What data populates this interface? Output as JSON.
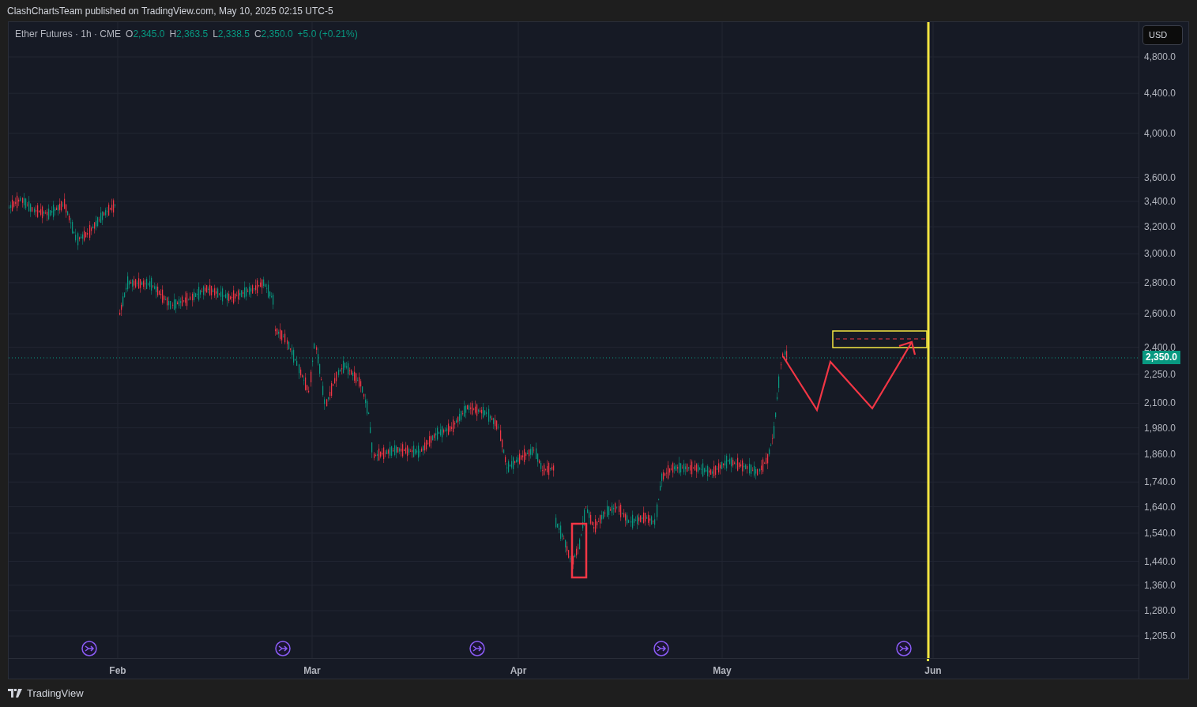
{
  "header": {
    "text": "ClashChartsTeam published on TradingView.com, May 10, 2025 02:15 UTC-5"
  },
  "legend": {
    "symbol": "Ether Futures · 1h · CME",
    "fields": [
      {
        "label": "O",
        "value": "2,345.0"
      },
      {
        "label": "H",
        "value": "2,363.5"
      },
      {
        "label": "L",
        "value": "2,338.5"
      },
      {
        "label": "C",
        "value": "2,350.0"
      }
    ],
    "change": "+5.0 (+0.21%)"
  },
  "currency_button": "USD",
  "price_axis": {
    "labels": [
      "4,800.0",
      "4,400.0",
      "4,000.0",
      "3,600.0",
      "3,400.0",
      "3,200.0",
      "3,000.0",
      "2,800.0",
      "2,600.0",
      "2,400.0",
      "2,250.0",
      "2,100.0",
      "1,980.0",
      "1,860.0",
      "1,740.0",
      "1,640.0",
      "1,540.0",
      "1,440.0",
      "1,360.0",
      "1,280.0",
      "1,205.0"
    ],
    "last_price": "2,350.0"
  },
  "time_axis": {
    "labels": [
      "Feb",
      "Mar",
      "Apr",
      "May",
      "Jun"
    ]
  },
  "footer": {
    "brand": "TradingView"
  }
}
